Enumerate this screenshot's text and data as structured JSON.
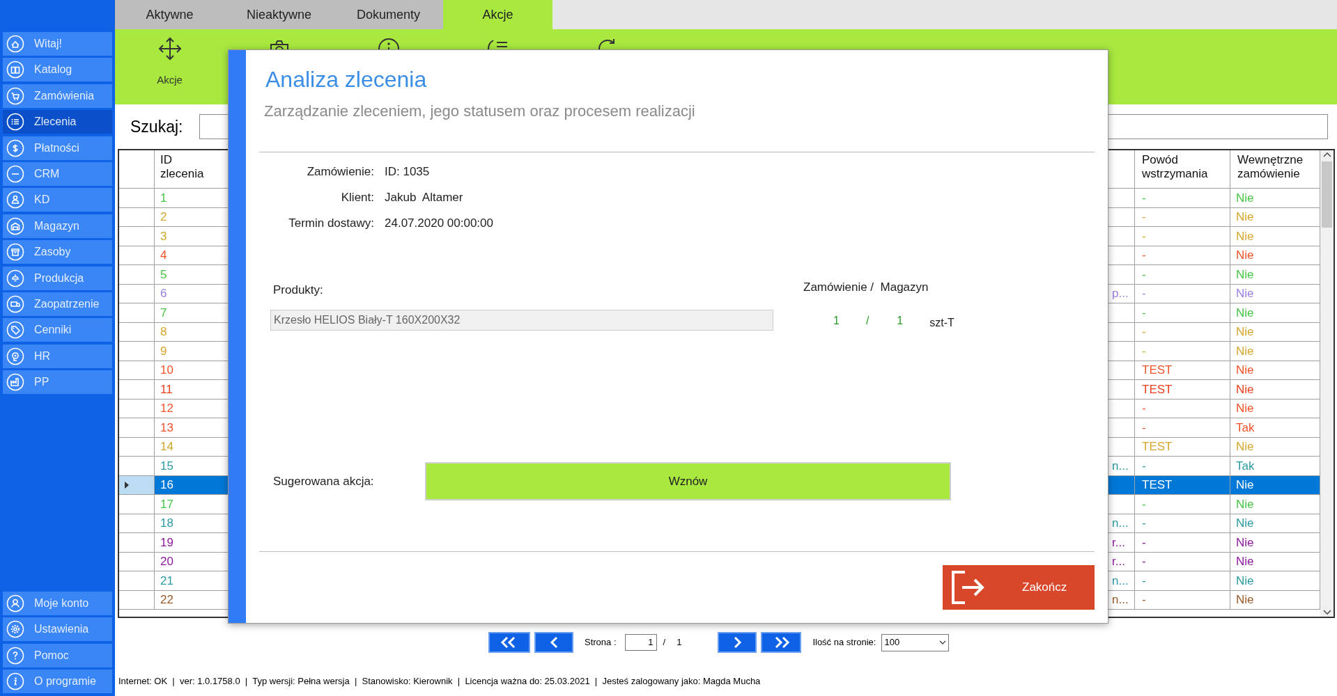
{
  "sidebar": {
    "items": [
      {
        "label": "Witaj!",
        "selected": false
      },
      {
        "label": "Katalog",
        "selected": false
      },
      {
        "label": "Zamówienia",
        "selected": false
      },
      {
        "label": "Zlecenia",
        "selected": true
      },
      {
        "label": "Płatności",
        "selected": false
      },
      {
        "label": "CRM",
        "selected": false
      },
      {
        "label": "KD",
        "selected": false
      },
      {
        "label": "Magazyn",
        "selected": false
      },
      {
        "label": "Zasoby",
        "selected": false
      },
      {
        "label": "Produkcja",
        "selected": false
      },
      {
        "label": "Zaopatrzenie",
        "selected": false
      },
      {
        "label": "Cenniki",
        "selected": false
      },
      {
        "label": "HR",
        "selected": false
      },
      {
        "label": "PP",
        "selected": false
      }
    ],
    "bottom_items": [
      {
        "label": "Moje konto",
        "selected": false
      },
      {
        "label": "Ustawienia",
        "selected": false
      },
      {
        "label": "Pomoc",
        "selected": false
      },
      {
        "label": "O programie",
        "selected": false
      }
    ]
  },
  "tabs": [
    {
      "label": "Aktywne",
      "selected": false
    },
    {
      "label": "Nieaktywne",
      "selected": false
    },
    {
      "label": "Dokumenty",
      "selected": false
    },
    {
      "label": "Akcje",
      "selected": true
    }
  ],
  "toolbar": {
    "label": "Akcje"
  },
  "search": {
    "label": "Szukaj:"
  },
  "table": {
    "columns": [
      "ID zlecenia",
      "Powód wstrzymania",
      "Wewnętrzne zamówienie"
    ],
    "rows": [
      {
        "id": "1",
        "powod": "-",
        "wewnetrzne": "Nie",
        "color": "#45c445",
        "selected": false
      },
      {
        "id": "2",
        "powod": "-",
        "wewnetrzne": "Nie",
        "color": "#d4a72c",
        "selected": false
      },
      {
        "id": "3",
        "powod": "-",
        "wewnetrzne": "Nie",
        "color": "#d4a72c",
        "selected": false
      },
      {
        "id": "4",
        "powod": "-",
        "wewnetrzne": "Nie",
        "color": "#f0522a",
        "selected": false
      },
      {
        "id": "5",
        "powod": "-",
        "wewnetrzne": "Nie",
        "color": "#45c445",
        "selected": false
      },
      {
        "id": "6",
        "column_3": "p...",
        "powod": "-",
        "wewnetrzne": "Nie",
        "color": "#9a7fe0",
        "selected": false
      },
      {
        "id": "7",
        "powod": "-",
        "wewnetrzne": "Nie",
        "color": "#45c445",
        "selected": false
      },
      {
        "id": "8",
        "powod": "-",
        "wewnetrzne": "Nie",
        "color": "#d4a72c",
        "selected": false
      },
      {
        "id": "9",
        "powod": "-",
        "wewnetrzne": "Nie",
        "color": "#d4a72c",
        "selected": false
      },
      {
        "id": "10",
        "powod": "TEST",
        "wewnetrzne": "Nie",
        "color": "#f0522a",
        "selected": false
      },
      {
        "id": "11",
        "powod": "TEST",
        "wewnetrzne": "Nie",
        "color": "#e8401e",
        "selected": false
      },
      {
        "id": "12",
        "powod": "-",
        "wewnetrzne": "Nie",
        "color": "#f0522a",
        "selected": false
      },
      {
        "id": "13",
        "powod": "-",
        "wewnetrzne": "Tak",
        "color": "#f0522a",
        "selected": false
      },
      {
        "id": "14",
        "powod": "TEST",
        "wewnetrzne": "Nie",
        "color": "#d4a72c",
        "selected": false
      },
      {
        "id": "15",
        "column_3": "n...",
        "powod": "-",
        "wewnetrzne": "Tak",
        "color": "#2a9aa0",
        "selected": false
      },
      {
        "id": "16",
        "powod": "TEST",
        "wewnetrzne": "Nie",
        "selected": true
      },
      {
        "id": "17",
        "powod": "-",
        "wewnetrzne": "Nie",
        "color": "#45c445",
        "selected": false
      },
      {
        "id": "18",
        "column_3": "n...",
        "powod": "-",
        "wewnetrzne": "Nie",
        "color": "#2a9aa0",
        "selected": false
      },
      {
        "id": "19",
        "column_3": "r...",
        "powod": "-",
        "wewnetrzne": "Nie",
        "color": "#8b1a9b",
        "selected": false
      },
      {
        "id": "20",
        "column_3": "r...",
        "powod": "-",
        "wewnetrzne": "Nie",
        "color": "#8b1a9b",
        "selected": false
      },
      {
        "id": "21",
        "column_3": "n...",
        "powod": "-",
        "wewnetrzne": "Nie",
        "color": "#2a9aa0",
        "selected": false
      },
      {
        "id": "22",
        "column_3": "n...",
        "powod": "-",
        "wewnetrzne": "Nie",
        "color": "#9a5a28",
        "selected": false
      }
    ]
  },
  "dialog": {
    "title": "Analiza zlecenia",
    "subtitle": "Zarządzanie zleceniem, jego statusem oraz procesem realizacji",
    "fields": [
      {
        "label": "Zamówienie:",
        "value": "ID: 1035"
      },
      {
        "label": "Klient:",
        "value": "Jakub  Altamer"
      },
      {
        "label": "Termin dostawy:",
        "value": "24.07.2020 00:00:00"
      }
    ],
    "products_label": "Produkty:",
    "quantity_header": "Zamówienie /  Magazyn",
    "products": [
      {
        "name": "Krzesło HELIOS Biały-T 160X200X32",
        "ordered": "1",
        "separator": "/",
        "stock": "1",
        "unit": "szt-T"
      }
    ],
    "suggested_label": "Sugerowana akcja:",
    "suggested_action": "Wznów",
    "close_button": "Zakończ"
  },
  "pagination": {
    "page_label": "Strona :",
    "page": "1",
    "separator": "/",
    "total": "1",
    "per_page_label": "Ilość na stronie:",
    "per_page": "100"
  },
  "status_bar": "Internet: OK  |  ver: 1.0.1758.0  |  Typ wersji: Pełna wersja  |  Stanowisko: Kierownik  |  Licencja ważna do: 25.03.2021  |  Jesteś zalogowany jako: Magda Mucha"
}
